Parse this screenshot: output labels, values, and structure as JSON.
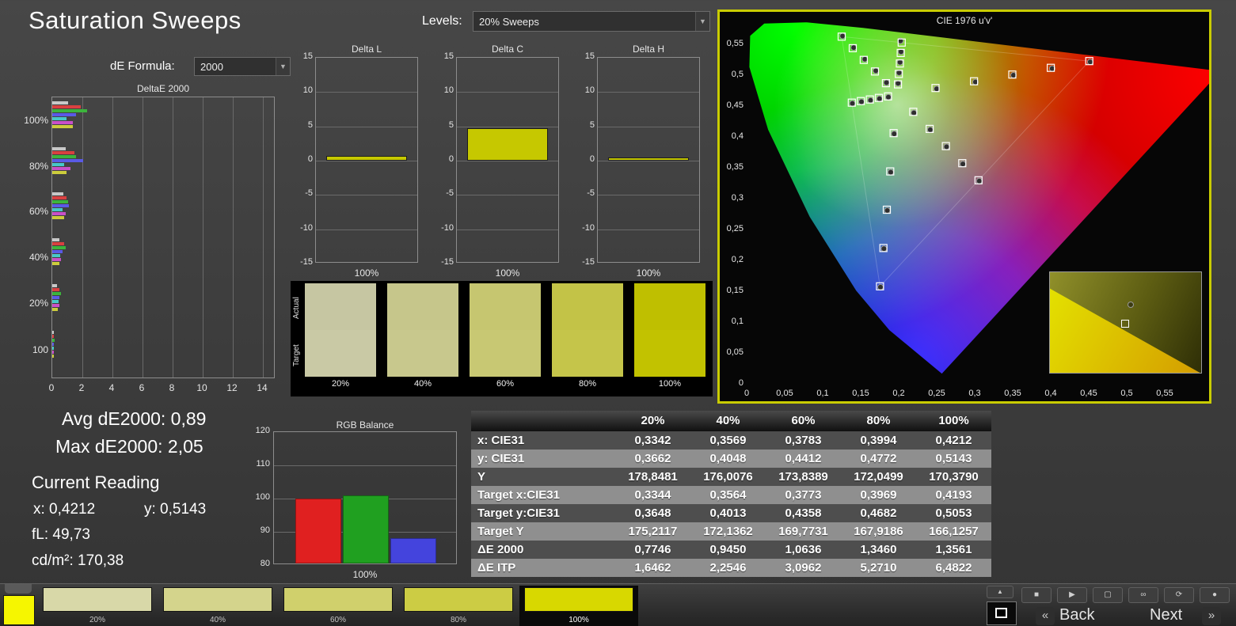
{
  "app": {
    "title": "Saturation Sweeps"
  },
  "header": {
    "levels_label": "Levels:",
    "levels_value": "20% Sweeps",
    "de_formula_label": "dE Formula:",
    "de_formula_value": "2000"
  },
  "stats": {
    "avg_de": "Avg dE2000: 0,89",
    "max_de": "Max dE2000: 2,05",
    "current_reading": "Current Reading",
    "x": "x: 0,4212",
    "y": "y: 0,5143",
    "fl": "fL: 49,73",
    "cd": "cd/m²: 170,38"
  },
  "swatch_panel": {
    "row_labels": [
      "Actual",
      "Target"
    ],
    "columns": [
      {
        "label": "20%",
        "actual": "#c6c6a2",
        "target": "#c9c9a5"
      },
      {
        "label": "40%",
        "actual": "#c6c68b",
        "target": "#c8c88d"
      },
      {
        "label": "60%",
        "actual": "#c6c670",
        "target": "#c8c873"
      },
      {
        "label": "80%",
        "actual": "#c3c347",
        "target": "#c5c54a"
      },
      {
        "label": "100%",
        "actual": "#bfbf00",
        "target": "#c2c200"
      }
    ]
  },
  "table": {
    "headers": [
      "",
      "20%",
      "40%",
      "60%",
      "80%",
      "100%"
    ],
    "rows": [
      {
        "label": "x: CIE31",
        "values": [
          "0,3342",
          "0,3569",
          "0,3783",
          "0,3994",
          "0,4212"
        ]
      },
      {
        "label": "y: CIE31",
        "values": [
          "0,3662",
          "0,4048",
          "0,4412",
          "0,4772",
          "0,5143"
        ]
      },
      {
        "label": "Y",
        "values": [
          "178,8481",
          "176,0076",
          "173,8389",
          "172,0499",
          "170,3790"
        ]
      },
      {
        "label": "Target x:CIE31",
        "values": [
          "0,3344",
          "0,3564",
          "0,3773",
          "0,3969",
          "0,4193"
        ]
      },
      {
        "label": "Target y:CIE31",
        "values": [
          "0,3648",
          "0,4013",
          "0,4358",
          "0,4682",
          "0,5053"
        ]
      },
      {
        "label": "Target Y",
        "values": [
          "175,2117",
          "172,1362",
          "169,7731",
          "167,9186",
          "166,1257"
        ]
      },
      {
        "label": "ΔE 2000",
        "values": [
          "0,7746",
          "0,9450",
          "1,0636",
          "1,3460",
          "1,3561"
        ]
      },
      {
        "label": "ΔE ITP",
        "values": [
          "1,6462",
          "2,2546",
          "3,0962",
          "5,2710",
          "6,4822"
        ]
      }
    ]
  },
  "bottom_bar": {
    "current_color": "#f6f600",
    "tabs": [
      {
        "label": "20%",
        "color": "#d8d8a8",
        "selected": false
      },
      {
        "label": "40%",
        "color": "#d4d48c",
        "selected": false
      },
      {
        "label": "60%",
        "color": "#d0d06c",
        "selected": false
      },
      {
        "label": "80%",
        "color": "#cccc44",
        "selected": false
      },
      {
        "label": "100%",
        "color": "#d8d800",
        "selected": true
      }
    ],
    "transport": [
      {
        "name": "stop",
        "glyph": "■"
      },
      {
        "name": "play",
        "glyph": "▶"
      },
      {
        "name": "pattern",
        "glyph": "▢"
      },
      {
        "name": "loop",
        "glyph": "∞"
      },
      {
        "name": "refresh",
        "glyph": "⟳"
      },
      {
        "name": "status",
        "glyph": "●"
      }
    ],
    "back_chevron": "«",
    "back_label": "Back",
    "next_label": "Next",
    "next_chevron": "»"
  },
  "chart_data": [
    {
      "id": "deltae2000",
      "type": "bar",
      "orientation": "horizontal",
      "title": "DeltaE 2000",
      "categories": [
        "100%",
        "80%",
        "60%",
        "40%",
        "20%",
        "100"
      ],
      "series": [
        {
          "name": "white",
          "color": "#c8c8c8",
          "values": [
            1.05,
            0.9,
            0.75,
            0.5,
            0.3,
            0.1
          ]
        },
        {
          "name": "red",
          "color": "#d94040",
          "values": [
            1.9,
            1.45,
            0.95,
            0.8,
            0.5,
            0.12
          ]
        },
        {
          "name": "green",
          "color": "#3cb43c",
          "values": [
            2.3,
            1.6,
            1.05,
            0.9,
            0.6,
            0.15
          ]
        },
        {
          "name": "blue",
          "color": "#5a5ae6",
          "values": [
            1.6,
            2.05,
            1.1,
            0.7,
            0.45,
            0.1
          ]
        },
        {
          "name": "cyan",
          "color": "#46c8c8",
          "values": [
            0.95,
            0.8,
            0.7,
            0.55,
            0.4,
            0.1
          ]
        },
        {
          "name": "magenta",
          "color": "#c850c8",
          "values": [
            1.35,
            1.2,
            0.9,
            0.6,
            0.5,
            0.12
          ]
        },
        {
          "name": "yellow",
          "color": "#cccc3c",
          "values": [
            1.36,
            0.95,
            0.8,
            0.5,
            0.35,
            0.1
          ]
        }
      ],
      "xlim": [
        0,
        14.85
      ],
      "xticks": [
        0,
        2,
        4,
        6,
        8,
        10,
        12,
        14
      ],
      "grid": true,
      "legend": "none"
    },
    {
      "id": "delta_l",
      "type": "bar",
      "title": "Delta L",
      "categories": [
        "100%"
      ],
      "values": [
        0.7
      ],
      "ylim": [
        -15,
        15
      ],
      "yticks": [
        15,
        10,
        5,
        0,
        -5,
        -10,
        -15
      ],
      "bar_color": "#c6c800",
      "grid": true
    },
    {
      "id": "delta_c",
      "type": "bar",
      "title": "Delta C",
      "categories": [
        "100%"
      ],
      "values": [
        4.7
      ],
      "ylim": [
        -15,
        15
      ],
      "yticks": [
        15,
        10,
        5,
        0,
        -5,
        -10,
        -15
      ],
      "bar_color": "#c6c800",
      "grid": true
    },
    {
      "id": "delta_h",
      "type": "bar",
      "title": "Delta H",
      "categories": [
        "100%"
      ],
      "values": [
        0.5
      ],
      "ylim": [
        -15,
        15
      ],
      "yticks": [
        15,
        10,
        5,
        0,
        -5,
        -10,
        -15
      ],
      "bar_color": "#c6c800",
      "grid": true
    },
    {
      "id": "rgb_balance",
      "type": "bar",
      "title": "RGB Balance",
      "categories": [
        "Red",
        "Green",
        "Blue"
      ],
      "values": [
        100,
        101,
        88
      ],
      "colors": [
        "#e02020",
        "#20a020",
        "#4444dd"
      ],
      "ylim": [
        80,
        120
      ],
      "yticks": [
        120,
        110,
        100,
        90,
        80
      ],
      "xlabel": "100%",
      "grid": true
    },
    {
      "id": "cie",
      "type": "scatter",
      "title": "CIE 1976 u'v'",
      "xlim": [
        0,
        0.6083
      ],
      "ylim": [
        0,
        0.5872
      ],
      "xticks": [
        "0",
        "0,05",
        "0,1",
        "0,15",
        "0,2",
        "0,25",
        "0,3",
        "0,35",
        "0,4",
        "0,45",
        "0,5",
        "0,55"
      ],
      "yticks": [
        "0,55",
        "0,5",
        "0,45",
        "0,4",
        "0,35",
        "0,3",
        "0,25",
        "0,2",
        "0,15",
        "0,1",
        "0,05",
        "0"
      ],
      "locus": [
        [
          0.2568,
          0.0166
        ],
        [
          0.1877,
          0.0871
        ],
        [
          0.1441,
          0.151
        ],
        [
          0.0828,
          0.2708
        ],
        [
          0.0282,
          0.4117
        ],
        [
          0.0035,
          0.5131
        ],
        [
          0.0046,
          0.5639
        ],
        [
          0.0231,
          0.5837
        ],
        [
          0.0792,
          0.5856
        ],
        [
          0.1531,
          0.5766
        ],
        [
          0.2623,
          0.5604
        ],
        [
          0.4035,
          0.5393
        ],
        [
          0.5203,
          0.5219
        ],
        [
          0.6005,
          0.5099
        ],
        [
          0.6234,
          0.5065
        ]
      ],
      "gamut_triangle": [
        [
          0.4507,
          0.5229
        ],
        [
          0.125,
          0.5625
        ],
        [
          0.1754,
          0.1579
        ]
      ],
      "targets": [
        [
          0.2484,
          0.4792
        ],
        [
          0.299,
          0.4901
        ],
        [
          0.3495,
          0.5011
        ],
        [
          0.4001,
          0.512
        ],
        [
          0.4507,
          0.5229
        ],
        [
          0.1832,
          0.4871
        ],
        [
          0.1687,
          0.506
        ],
        [
          0.1541,
          0.5248
        ],
        [
          0.1396,
          0.5437
        ],
        [
          0.125,
          0.5625
        ],
        [
          0.1933,
          0.4062
        ],
        [
          0.1888,
          0.3441
        ],
        [
          0.1844,
          0.2821
        ],
        [
          0.1799,
          0.22
        ],
        [
          0.1754,
          0.1579
        ],
        [
          0.1859,
          0.4657
        ],
        [
          0.174,
          0.4632
        ],
        [
          0.1621,
          0.4606
        ],
        [
          0.1502,
          0.4581
        ],
        [
          0.1383,
          0.4555
        ],
        [
          0.2192,
          0.4406
        ],
        [
          0.2407,
          0.4129
        ],
        [
          0.2621,
          0.3852
        ],
        [
          0.2836,
          0.3575
        ],
        [
          0.305,
          0.3298
        ],
        [
          0.199,
          0.4852
        ],
        [
          0.2002,
          0.5021
        ],
        [
          0.2015,
          0.519
        ],
        [
          0.2027,
          0.536
        ],
        [
          0.2039,
          0.5529
        ]
      ],
      "measurements": [
        [
          0.25,
          0.478
        ],
        [
          0.301,
          0.489
        ],
        [
          0.351,
          0.5
        ],
        [
          0.402,
          0.5108
        ],
        [
          0.452,
          0.5215
        ],
        [
          0.184,
          0.488
        ],
        [
          0.17,
          0.5072
        ],
        [
          0.1555,
          0.526
        ],
        [
          0.1408,
          0.5448
        ],
        [
          0.1262,
          0.5635
        ],
        [
          0.194,
          0.405
        ],
        [
          0.1895,
          0.3428
        ],
        [
          0.185,
          0.2808
        ],
        [
          0.1806,
          0.2188
        ],
        [
          0.176,
          0.1565
        ],
        [
          0.1865,
          0.4645
        ],
        [
          0.1748,
          0.462
        ],
        [
          0.163,
          0.4594
        ],
        [
          0.151,
          0.457
        ],
        [
          0.1392,
          0.4543
        ],
        [
          0.22,
          0.439
        ],
        [
          0.2415,
          0.4115
        ],
        [
          0.263,
          0.384
        ],
        [
          0.2845,
          0.356
        ],
        [
          0.306,
          0.3285
        ],
        [
          0.1992,
          0.487
        ],
        [
          0.2005,
          0.504
        ],
        [
          0.2018,
          0.521
        ],
        [
          0.203,
          0.538
        ],
        [
          0.2023,
          0.5557
        ]
      ],
      "inset": {
        "circle": [
          0.53,
          0.32
        ],
        "square": [
          0.49,
          0.5
        ]
      }
    }
  ]
}
